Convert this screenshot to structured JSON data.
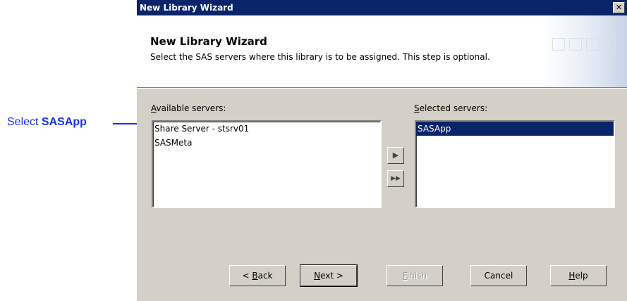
{
  "callout": {
    "prefix": "Select ",
    "target": "SASApp"
  },
  "window": {
    "title": "New Library Wizard",
    "close_glyph": "✕"
  },
  "header": {
    "title": "New Library Wizard",
    "subtitle": "Select the SAS servers where this library is to be assigned. This step is optional."
  },
  "available": {
    "label_prefix": "",
    "label_accel": "A",
    "label_rest": "vailable servers:",
    "items": [
      "Share Server - stsrv01",
      "SASMeta"
    ]
  },
  "selected": {
    "label_prefix": "",
    "label_accel": "S",
    "label_rest": "elected servers:",
    "items": [
      "SASApp"
    ]
  },
  "move_buttons": {
    "move_one": "▶",
    "move_all": "▶▶"
  },
  "buttons": {
    "back": {
      "prefix": "< ",
      "accel": "B",
      "rest": "ack"
    },
    "next": {
      "prefix": "",
      "accel": "N",
      "rest": "ext >"
    },
    "finish": {
      "prefix": "",
      "accel": "F",
      "rest": "inish"
    },
    "cancel": "Cancel",
    "help": {
      "prefix": "",
      "accel": "H",
      "rest": "elp"
    }
  }
}
